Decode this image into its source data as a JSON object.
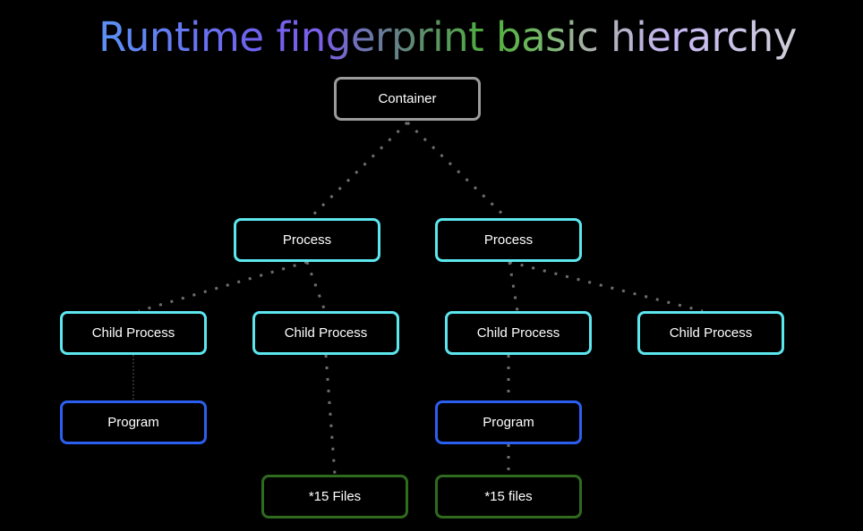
{
  "title": "Runtime fingerprint basic hierarchy",
  "colors": {
    "background": "#000000",
    "container_border": "#9b9b9b",
    "process_border": "#5ce6ee",
    "program_border": "#2b5ff0",
    "files_border": "#2f6a1f",
    "connector": "#6e6e6e",
    "text": "#ffffff"
  },
  "nodes": {
    "container": {
      "label": "Container"
    },
    "process_left": {
      "label": "Process"
    },
    "process_right": {
      "label": "Process"
    },
    "child_1": {
      "label": "Child Process"
    },
    "child_2": {
      "label": "Child Process"
    },
    "child_3": {
      "label": "Child Process"
    },
    "child_4": {
      "label": "Child Process"
    },
    "program_left": {
      "label": "Program"
    },
    "program_right": {
      "label": "Program"
    },
    "files_left": {
      "label": "*15 Files"
    },
    "files_right": {
      "label": "*15 files"
    }
  },
  "edges": [
    {
      "from": "container",
      "to": "process_left"
    },
    {
      "from": "container",
      "to": "process_right"
    },
    {
      "from": "process_left",
      "to": "child_1"
    },
    {
      "from": "process_left",
      "to": "child_2"
    },
    {
      "from": "process_right",
      "to": "child_3"
    },
    {
      "from": "process_right",
      "to": "child_4"
    },
    {
      "from": "child_1",
      "to": "program_left"
    },
    {
      "from": "child_2",
      "to": "files_left"
    },
    {
      "from": "child_3",
      "to": "program_right"
    },
    {
      "from": "program_right",
      "to": "files_right"
    }
  ]
}
